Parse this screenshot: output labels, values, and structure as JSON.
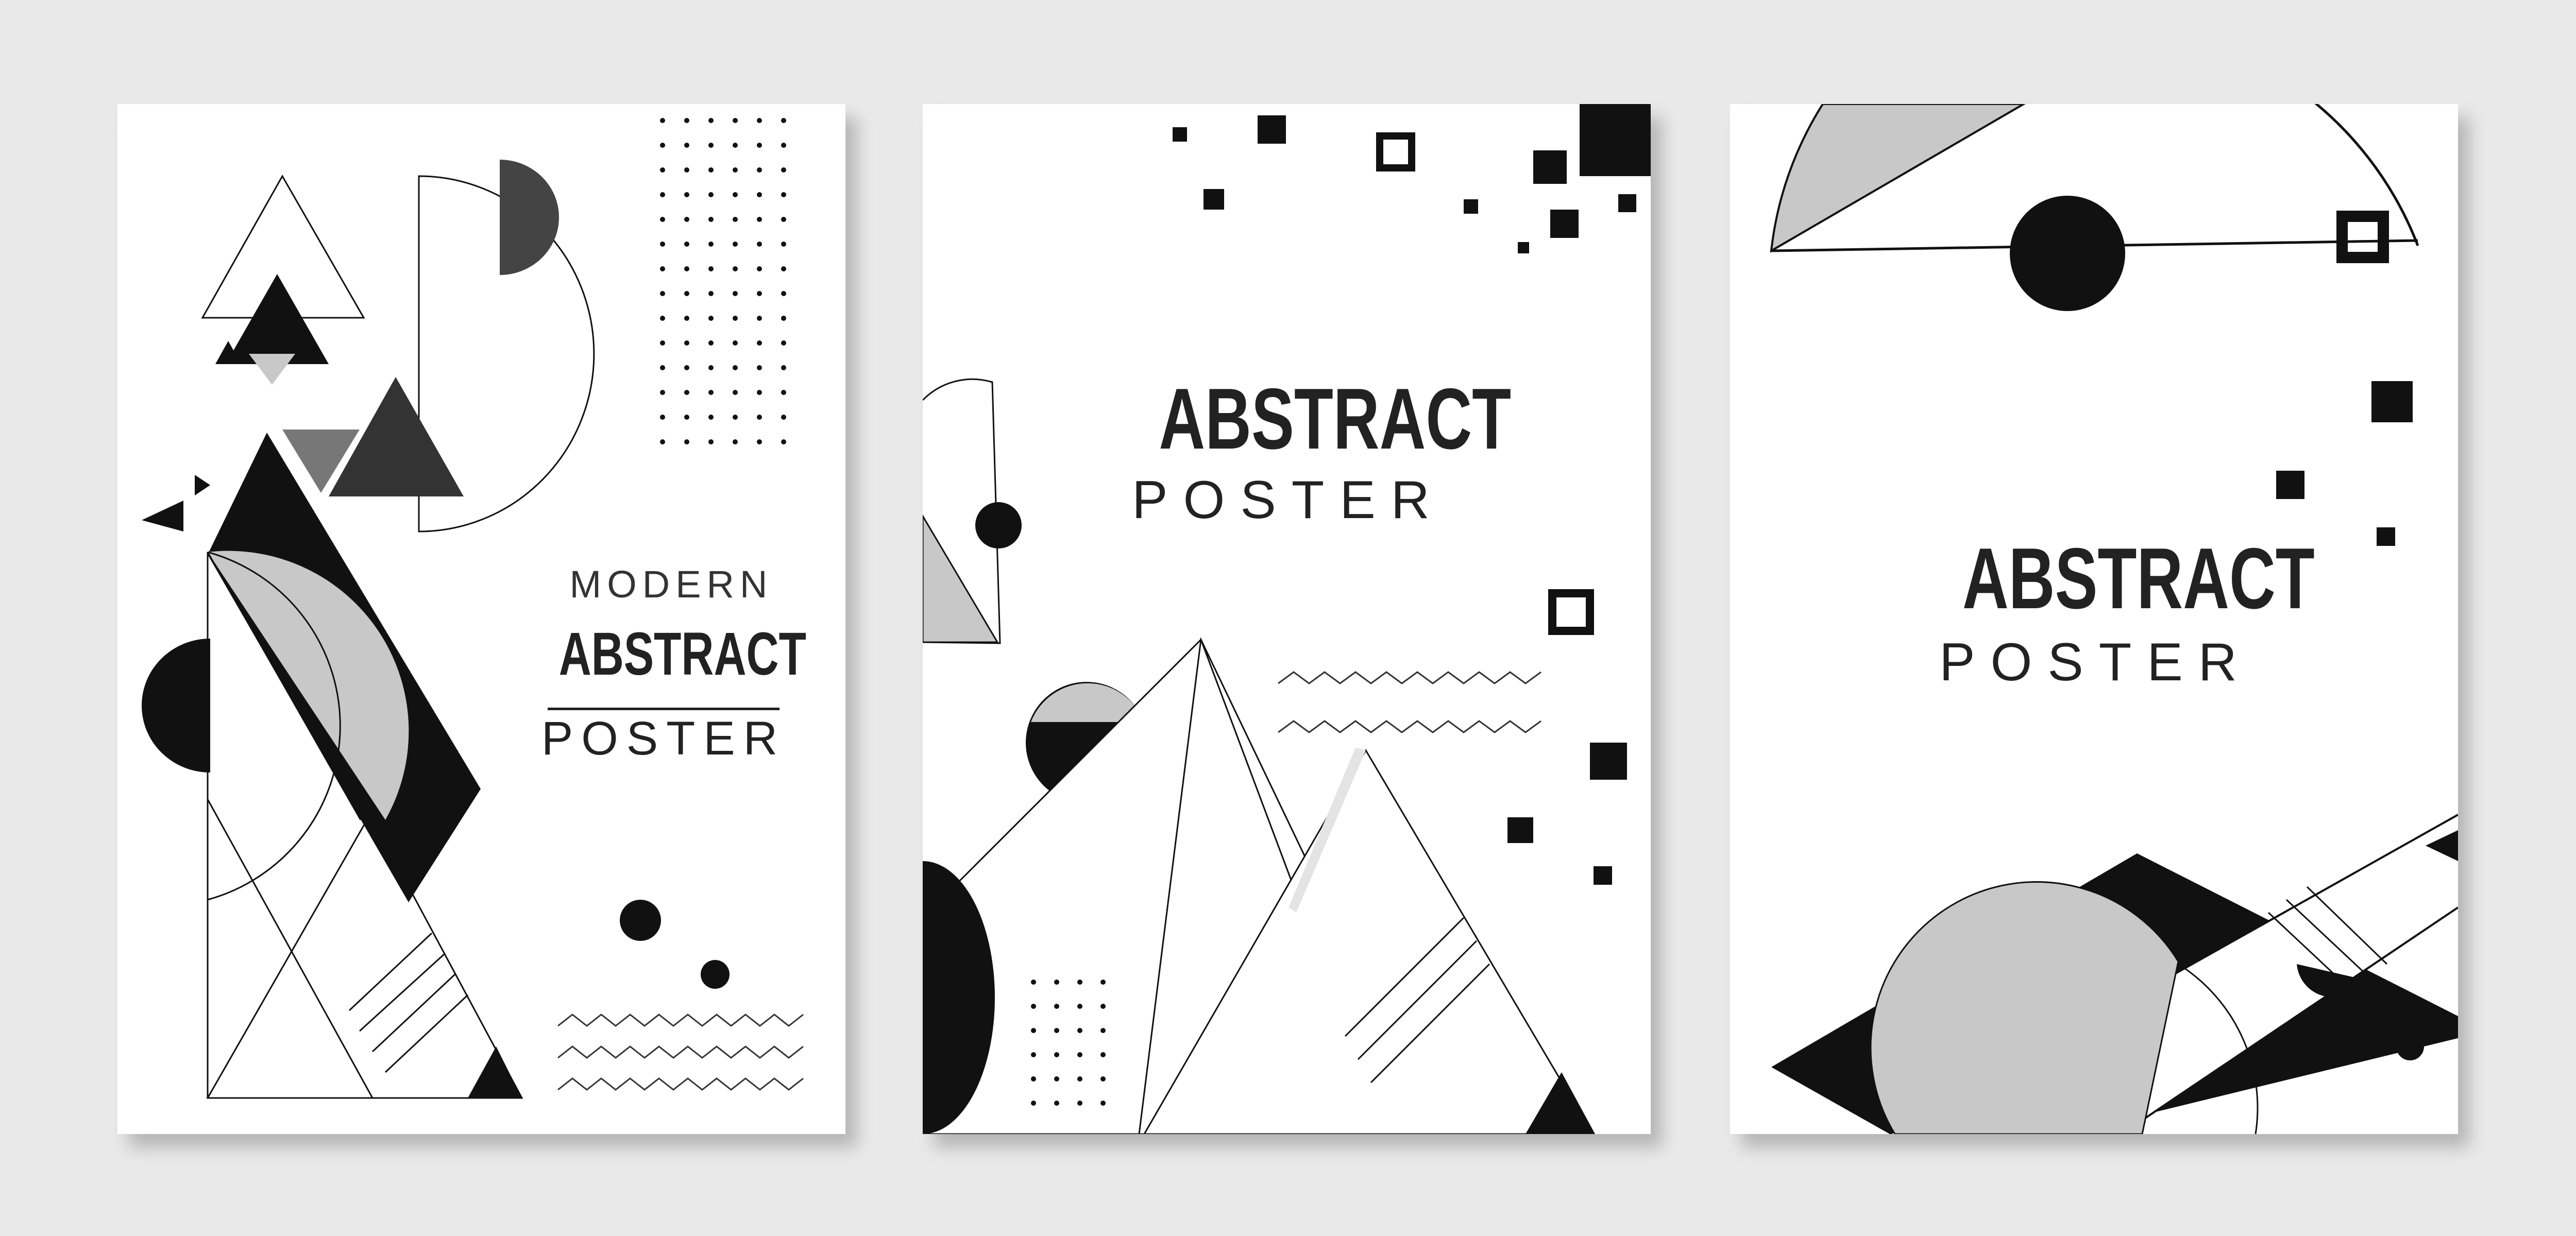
{
  "posters": [
    {
      "title_top": "MODERN",
      "title_main": "ABSTRACT",
      "title_sub": "POSTER"
    },
    {
      "title_main": "ABSTRACT",
      "title_sub": "POSTER"
    },
    {
      "title_main": "ABSTRACT",
      "title_sub": "POSTER"
    }
  ],
  "colors": {
    "background": "#e9e9e9",
    "paper": "#ffffff",
    "black": "#111111",
    "dark_gray": "#333333",
    "mid_gray": "#6e6e6e",
    "light_gray": "#c8c8c8"
  }
}
